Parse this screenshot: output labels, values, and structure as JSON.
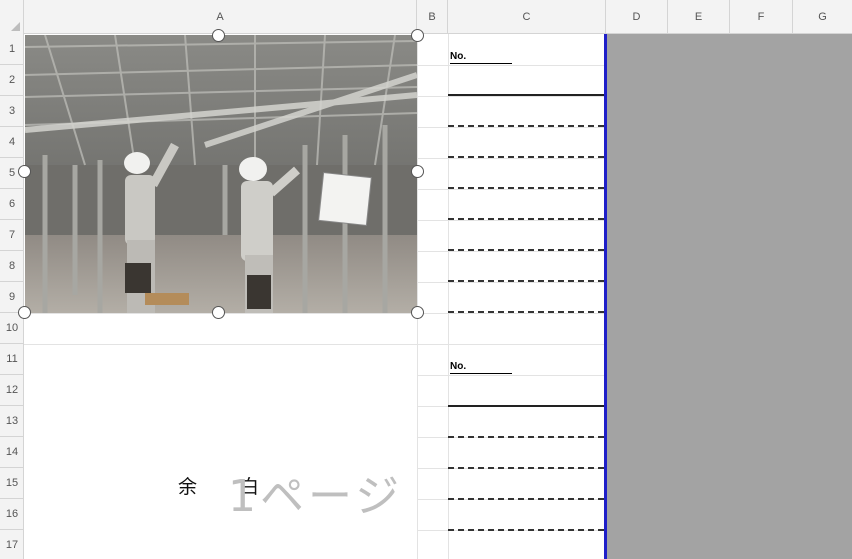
{
  "columns": [
    "A",
    "B",
    "C",
    "D",
    "E",
    "F",
    "G"
  ],
  "rows": [
    "1",
    "2",
    "3",
    "4",
    "5",
    "6",
    "7",
    "8",
    "9",
    "10",
    "11",
    "12",
    "13",
    "14",
    "15",
    "16",
    "17"
  ],
  "form_blocks": [
    {
      "no_label": "No."
    },
    {
      "no_label": "No."
    }
  ],
  "margin_label": {
    "char1": "余",
    "char2": "白"
  },
  "page_watermark": "1ページ",
  "photo": {
    "description_icon": "construction-workers-photo"
  },
  "colors": {
    "page_border": "#1f1fc8",
    "out_of_print_area": "#a3a3a3"
  }
}
